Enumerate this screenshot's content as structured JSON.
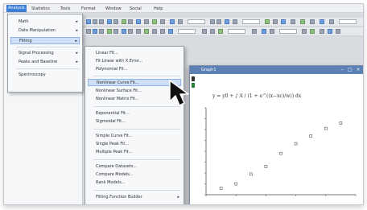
{
  "menubar": {
    "items": [
      {
        "label": "Analysis",
        "active": true
      },
      {
        "label": "Statistics"
      },
      {
        "label": "Tools"
      },
      {
        "label": "Format"
      },
      {
        "label": "Window"
      },
      {
        "label": "Social"
      },
      {
        "label": "Help"
      }
    ]
  },
  "main_menu": {
    "items": [
      {
        "label": "Math",
        "has_submenu": true
      },
      {
        "label": "Data Manipulation",
        "has_submenu": true
      },
      {
        "label": "Fitting",
        "has_submenu": true,
        "highlighted": true
      },
      {
        "label": "Signal Processing",
        "has_submenu": true
      },
      {
        "label": "Peaks and Baseline",
        "has_submenu": true
      },
      {
        "label": "Spectroscopy",
        "has_submenu": false
      }
    ]
  },
  "fitting_submenu": {
    "groups": [
      [
        {
          "label": "Linear Fit..."
        },
        {
          "label": "Fit Linear with X Error..."
        },
        {
          "label": "Polynomial Fit..."
        }
      ],
      [
        {
          "label": "Nonlinear Curve Fit...",
          "highlighted": true
        },
        {
          "label": "Nonlinear Surface Fit..."
        },
        {
          "label": "Nonlinear Matrix Fit..."
        }
      ],
      [
        {
          "label": "Exponential Fit..."
        },
        {
          "label": "Sigmoidal Fit..."
        }
      ],
      [
        {
          "label": "Simple Curve Fit..."
        },
        {
          "label": "Single Peak Fit..."
        },
        {
          "label": "Multiple Peak Fit..."
        }
      ],
      [
        {
          "label": "Compare Datasets..."
        },
        {
          "label": "Compare Models..."
        },
        {
          "label": "Rank Models..."
        }
      ],
      [
        {
          "label": "Fitting Function Builder",
          "has_submenu": true
        }
      ]
    ]
  },
  "graph_window": {
    "title": "Graph1"
  },
  "equation": "y = y0 + ∫ A / (1 + e^((x−xc)/w)) dx",
  "colors": {
    "accent": "#3d7fd6",
    "highlight": "#cfe0f6",
    "window_title": "#5b80b5"
  },
  "icons": [
    "menu-arrow-icon",
    "mouse-cursor-icon"
  ],
  "chart_data": {
    "type": "scatter",
    "series": [
      {
        "x": [
          1,
          2,
          3,
          4,
          5,
          6,
          7,
          8,
          9
        ],
        "y": [
          0.6,
          1.0,
          1.9,
          2.6,
          3.8,
          4.7,
          5.4,
          6.1,
          6.6
        ]
      }
    ],
    "xlim": [
      0,
      10
    ],
    "ylim": [
      0,
      8
    ],
    "grid": false
  }
}
